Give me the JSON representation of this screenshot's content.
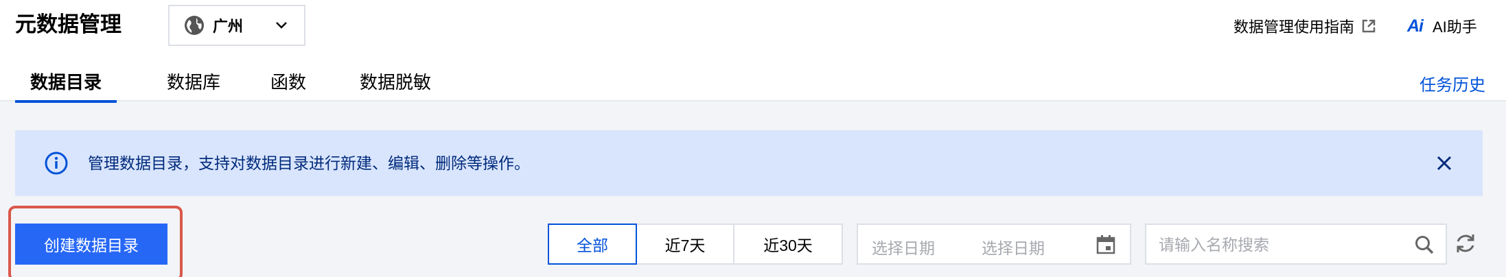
{
  "header": {
    "title": "元数据管理",
    "region": "广州",
    "guide_link": "数据管理使用指南",
    "ai_icon": "Ai",
    "ai_label": "AI助手"
  },
  "tabs": [
    {
      "label": "数据目录",
      "active": true
    },
    {
      "label": "数据库",
      "active": false
    },
    {
      "label": "函数",
      "active": false
    },
    {
      "label": "数据脱敏",
      "active": false
    }
  ],
  "history_link": "任务历史",
  "alert": {
    "message": "管理数据目录，支持对数据目录进行新建、编辑、删除等操作。"
  },
  "toolbar": {
    "create_button": "创建数据目录",
    "time_filters": [
      {
        "label": "全部",
        "active": true
      },
      {
        "label": "近7天",
        "active": false
      },
      {
        "label": "近30天",
        "active": false
      }
    ],
    "date_start_placeholder": "选择日期",
    "date_end_placeholder": "选择日期",
    "search_placeholder": "请输入名称搜索"
  },
  "colors": {
    "accent": "#0052d9",
    "primary_button": "#2667f6",
    "alert_bg": "#d9e5fc",
    "highlight_border": "#d9584b"
  }
}
